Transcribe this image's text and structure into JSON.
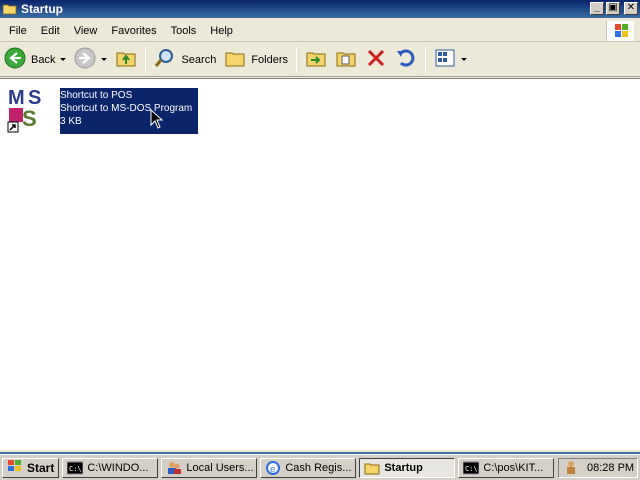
{
  "window": {
    "title": "Startup",
    "minimize_label": "_",
    "maximize_label": "▣",
    "close_label": "✕"
  },
  "menu": [
    "File",
    "Edit",
    "View",
    "Favorites",
    "Tools",
    "Help"
  ],
  "toolbar": {
    "back_label": "Back",
    "search_label": "Search",
    "folders_label": "Folders"
  },
  "file": {
    "name": "Shortcut to POS",
    "type": "Shortcut to MS-DOS Program",
    "size": "3 KB"
  },
  "taskbar": {
    "start_label": "Start",
    "tasks": [
      {
        "label": "C:\\WINDO..."
      },
      {
        "label": "Local Users..."
      },
      {
        "label": "Cash Regis..."
      },
      {
        "label": "Startup"
      },
      {
        "label": "C:\\pos\\KIT..."
      }
    ],
    "clock": "08:28 PM"
  },
  "colors": {
    "title_bar": "#0a246a",
    "selection": "#0a246a",
    "chrome": "#ece9d8",
    "desktop": "#3a6ea5"
  }
}
